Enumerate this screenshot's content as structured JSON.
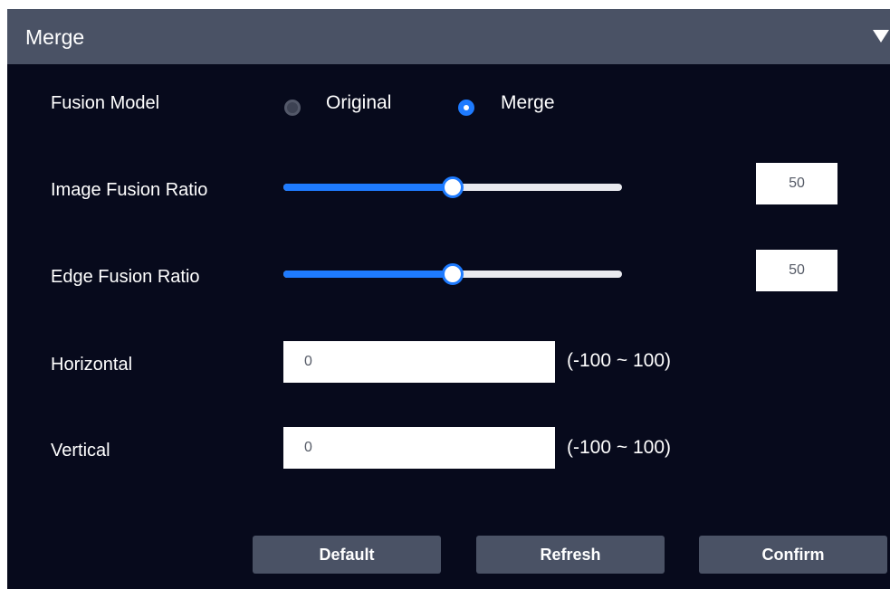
{
  "header": {
    "title": "Merge",
    "collapse_icon": "triangle-down-icon"
  },
  "fusion_model": {
    "label": "Fusion Model",
    "options": [
      {
        "label": "Original",
        "selected": false
      },
      {
        "label": "Merge",
        "selected": true
      }
    ]
  },
  "image_fusion_ratio": {
    "label": "Image Fusion Ratio",
    "value": "50",
    "fraction": 0.5
  },
  "edge_fusion_ratio": {
    "label": "Edge Fusion Ratio",
    "value": "50",
    "fraction": 0.5
  },
  "horizontal": {
    "label": "Horizontal",
    "value": "0",
    "range": "(-100 ~ 100)"
  },
  "vertical": {
    "label": "Vertical",
    "value": "0",
    "range": "(-100 ~ 100)"
  },
  "buttons": {
    "default": "Default",
    "refresh": "Refresh",
    "confirm": "Confirm"
  },
  "colors": {
    "panel_background": "#070a1c",
    "header_background": "#4a5265",
    "accent": "#1e7bff",
    "button_background": "#4a5265"
  }
}
